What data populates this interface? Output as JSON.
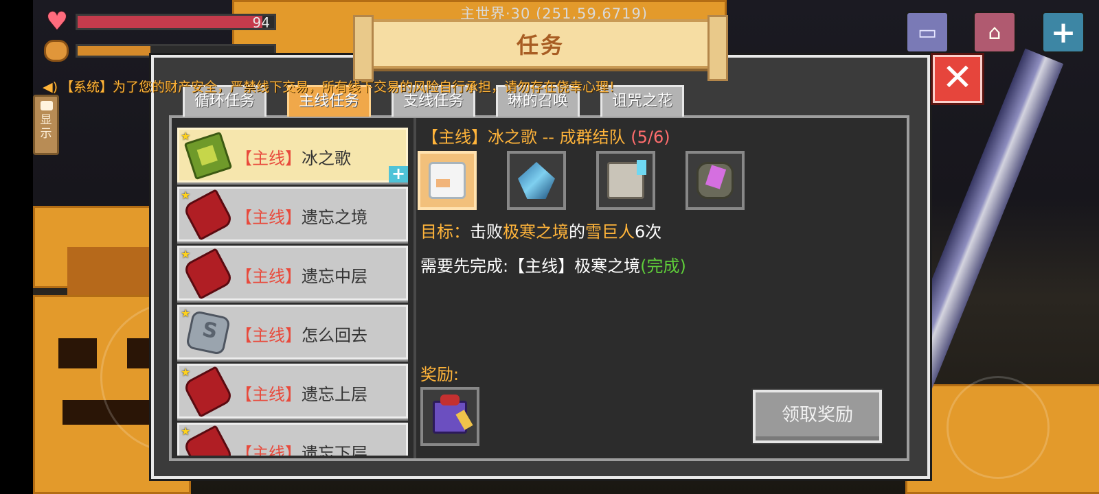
{
  "hud": {
    "hp_value": "94",
    "hp_fraction": 0.94,
    "hunger_fraction": 0.37,
    "world_coords": "主世界·30 (251,59,6719)",
    "display_button": "显示"
  },
  "system_message": {
    "text": "【系统】为了您的财产安全，严禁线下交易，所有线下交易的风险自行承担，请勿存在侥幸心理！"
  },
  "dialog": {
    "title": "任务",
    "tabs": [
      {
        "label": "循环任务",
        "active": false
      },
      {
        "label": "主线任务",
        "active": true
      },
      {
        "label": "支线任务",
        "active": false
      },
      {
        "label": "琳的召唤",
        "active": false
      },
      {
        "label": "诅咒之花",
        "active": false
      }
    ],
    "quests": [
      {
        "tag": "【主线】",
        "name": "冰之歌",
        "icon": "book-icon",
        "selected": true
      },
      {
        "tag": "【主线】",
        "name": "遗忘之境",
        "icon": "scroll-icon",
        "selected": false
      },
      {
        "tag": "【主线】",
        "name": "遗忘中层",
        "icon": "scroll-icon",
        "selected": false
      },
      {
        "tag": "【主线】",
        "name": "怎么回去",
        "icon": "rune-stone-icon",
        "selected": false
      },
      {
        "tag": "【主线】",
        "name": "遗忘上层",
        "icon": "scroll-icon",
        "selected": false
      },
      {
        "tag": "【主线】",
        "name": "遗忘下层",
        "icon": "scroll-icon",
        "selected": false
      }
    ],
    "detail": {
      "title": "【主线】冰之歌 -- 成群结队 ",
      "progress": "(5/6)",
      "target_items": [
        "snow-golem-icon",
        "ice-crystal-icon",
        "ice-golem-icon",
        "amethyst-ore-icon"
      ],
      "objective_label": "目标：",
      "objective_pre": "击败",
      "objective_place": "极寒之境",
      "objective_mid": "的",
      "objective_enemy": "雪巨人",
      "objective_count": "6次",
      "prereq_text": "需要先完成:【主线】极寒之境",
      "prereq_status": "(完成)",
      "reward_label": "奖励:",
      "reward_item": "gift-box-icon",
      "claim_button": "领取奖励"
    }
  },
  "colors": {
    "accent_orange": "#ffb43a",
    "tag_red": "#e84a3c",
    "done_green": "#5fcf3a",
    "close_red": "#e6453c"
  }
}
